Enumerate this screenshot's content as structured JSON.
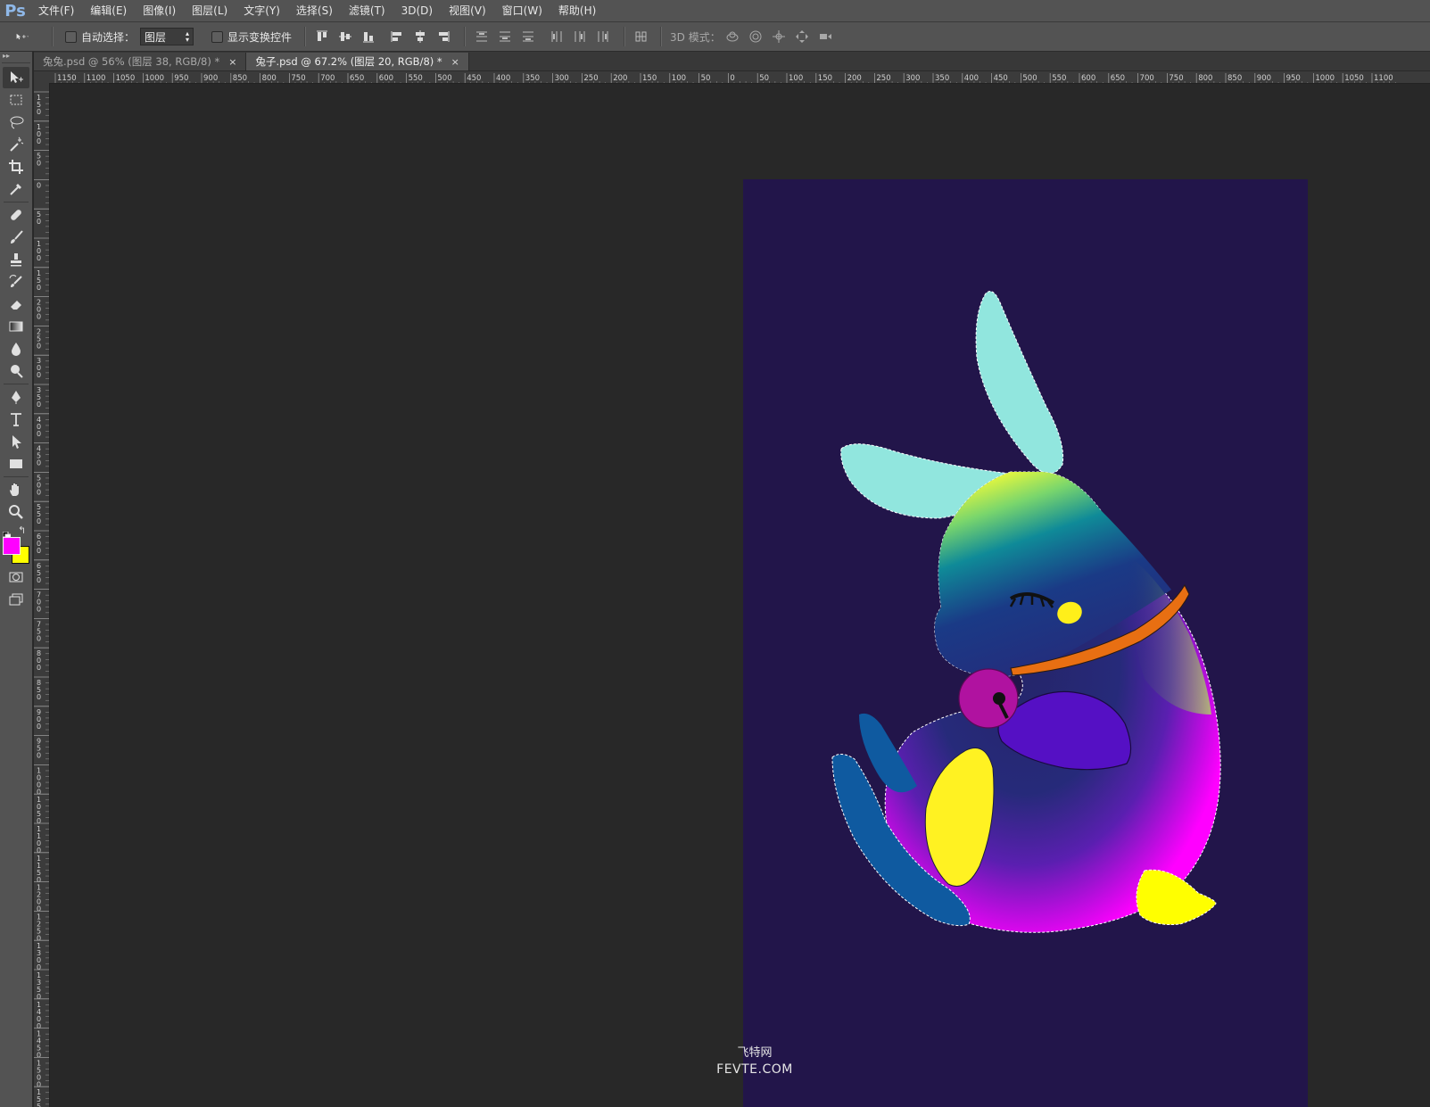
{
  "app": {
    "logo": "Ps"
  },
  "menu": [
    "文件(F)",
    "编辑(E)",
    "图像(I)",
    "图层(L)",
    "文字(Y)",
    "选择(S)",
    "滤镜(T)",
    "3D(D)",
    "视图(V)",
    "窗口(W)",
    "帮助(H)"
  ],
  "options": {
    "auto_select_label": "自动选择：",
    "auto_select_value": "图层",
    "show_transform_label": "显示变换控件",
    "mode_3d_label": "3D 模式："
  },
  "tabs": [
    {
      "label": "兔兔.psd @ 56% (图层 38, RGB/8) *",
      "close": "×",
      "active": false
    },
    {
      "label": "兔子.psd @ 67.2% (图层 20, RGB/8) *",
      "close": "×",
      "active": true
    }
  ],
  "colors": {
    "foreground": "#ff00ff",
    "background": "#ffff00",
    "document_bg": "#22154a"
  },
  "ruler": {
    "top_labels": [
      "1150",
      "1100",
      "1050",
      "1000",
      "950",
      "900",
      "850",
      "800",
      "750",
      "700",
      "650",
      "600",
      "550",
      "500",
      "450",
      "400",
      "350",
      "300",
      "250",
      "200",
      "150",
      "100",
      "50",
      "0",
      "50",
      "100",
      "150",
      "200",
      "250",
      "300",
      "350",
      "400",
      "450",
      "500",
      "550",
      "600",
      "650",
      "700",
      "750",
      "800",
      "850",
      "900",
      "950",
      "1000",
      "1050",
      "1100"
    ],
    "left_labels": [
      "150",
      "100",
      "50",
      "0",
      "50",
      "100",
      "150",
      "200",
      "250",
      "300",
      "350",
      "400",
      "450",
      "500",
      "550",
      "600",
      "650",
      "700",
      "750",
      "800",
      "850",
      "900",
      "950",
      "1000",
      "1050",
      "1100",
      "1150",
      "1200",
      "1250",
      "1300",
      "1350",
      "1400",
      "1450",
      "1500",
      "1550"
    ]
  },
  "tools": [
    "move-tool-icon",
    "marquee-tool-icon",
    "lasso-tool-icon",
    "magic-wand-icon",
    "crop-tool-icon",
    "eyedropper-icon",
    "healing-brush-icon",
    "brush-tool-icon",
    "clone-stamp-icon",
    "history-brush-icon",
    "eraser-icon",
    "gradient-tool-icon",
    "blur-tool-icon",
    "dodge-tool-icon",
    "pen-tool-icon",
    "type-tool-icon",
    "path-select-icon",
    "rectangle-tool-icon",
    "hand-tool-icon",
    "zoom-tool-icon"
  ],
  "watermark": {
    "line1": "飞特网",
    "line2": "FEVTE.COM"
  }
}
